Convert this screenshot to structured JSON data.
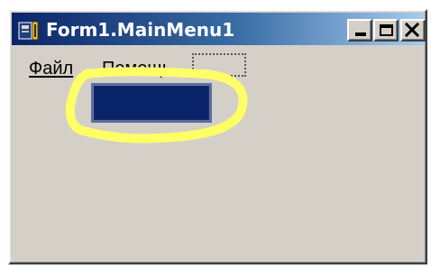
{
  "window": {
    "title": "Form1.MainMenu1",
    "caption_buttons": [
      {
        "name": "minimize",
        "icon": "minimize-icon"
      },
      {
        "name": "maximize",
        "icon": "maximize-icon"
      },
      {
        "name": "close",
        "icon": "close-icon"
      }
    ],
    "colors": {
      "title_start": "#0a246a",
      "title_end": "#a6caf0",
      "face": "#d4d0c8",
      "highlight_ring": "#ffff66"
    }
  },
  "menu": {
    "items": [
      {
        "label": "Файл"
      },
      {
        "label": "Помощь"
      }
    ],
    "placeholder_label": ""
  },
  "submenu": {
    "selected_item_label": ""
  },
  "icons": {
    "app": "delphi-form-icon"
  }
}
